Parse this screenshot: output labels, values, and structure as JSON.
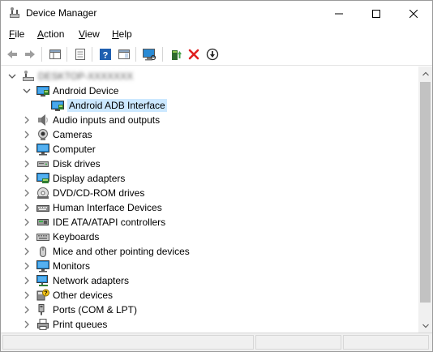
{
  "window": {
    "title": "Device Manager",
    "controls": {
      "minimize": "minimize",
      "maximize": "maximize",
      "close": "close"
    }
  },
  "menu": [
    {
      "key": "F",
      "rest": "ile"
    },
    {
      "key": "A",
      "rest": "ction"
    },
    {
      "key": "V",
      "rest": "iew"
    },
    {
      "key": "H",
      "rest": "elp"
    }
  ],
  "toolbar": {
    "buttons": [
      "back-arrow-icon",
      "forward-arrow-icon",
      "show-hide-console-tree-icon",
      "properties-icon",
      "help-icon",
      "action-pane-icon",
      "scan-hardware-changes-icon",
      "update-driver-icon",
      "uninstall-device-icon",
      "disable-device-icon"
    ]
  },
  "tree": {
    "root": {
      "label": "DESKTOP-XXXXXXX",
      "expanded": true
    },
    "android_device": {
      "label": "Android Device",
      "expanded": true
    },
    "android_adb": {
      "label": "Android ADB Interface",
      "selected": true
    },
    "categories": [
      {
        "label": "Audio inputs and outputs",
        "icon": "speaker-icon"
      },
      {
        "label": "Cameras",
        "icon": "camera-icon"
      },
      {
        "label": "Computer",
        "icon": "computer-icon"
      },
      {
        "label": "Disk drives",
        "icon": "disk-drive-icon"
      },
      {
        "label": "Display adapters",
        "icon": "display-adapter-icon"
      },
      {
        "label": "DVD/CD-ROM drives",
        "icon": "dvd-drive-icon"
      },
      {
        "label": "Human Interface Devices",
        "icon": "hid-icon"
      },
      {
        "label": "IDE ATA/ATAPI controllers",
        "icon": "ide-controller-icon"
      },
      {
        "label": "Keyboards",
        "icon": "keyboard-icon"
      },
      {
        "label": "Mice and other pointing devices",
        "icon": "mouse-icon"
      },
      {
        "label": "Monitors",
        "icon": "monitor-icon"
      },
      {
        "label": "Network adapters",
        "icon": "network-adapter-icon"
      },
      {
        "label": "Other devices",
        "icon": "other-devices-icon"
      },
      {
        "label": "Ports (COM & LPT)",
        "icon": "ports-icon"
      },
      {
        "label": "Print queues",
        "icon": "printer-icon"
      }
    ]
  },
  "colors": {
    "selection": "#cce8ff",
    "monitor_blue": "#1e88d6",
    "adb_green": "#2e7d32",
    "close_red": "#e81123"
  }
}
